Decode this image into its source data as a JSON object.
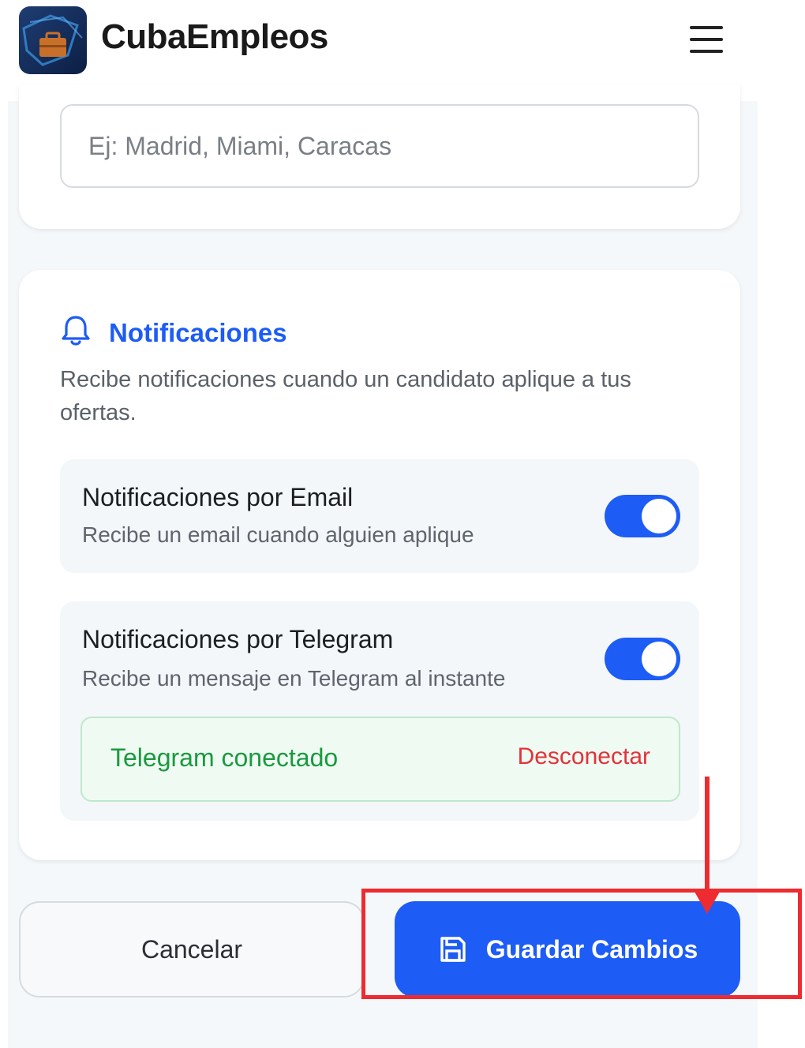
{
  "header": {
    "brand": "CubaEmpleos"
  },
  "location": {
    "placeholder": "Ej: Madrid, Miami, Caracas",
    "value": ""
  },
  "notifications": {
    "title": "Notificaciones",
    "description": "Recibe notificaciones cuando un candidato aplique a tus ofertas.",
    "email": {
      "title": "Notificaciones por Email",
      "subtitle": "Recibe un email cuando alguien aplique",
      "enabled": true
    },
    "telegram": {
      "title": "Notificaciones por Telegram",
      "subtitle": "Recibe un mensaje en Telegram al instante",
      "enabled": true,
      "status_text": "Telegram conectado",
      "disconnect_label": "Desconectar"
    }
  },
  "actions": {
    "cancel_label": "Cancelar",
    "save_label": "Guardar Cambios"
  },
  "icons": {
    "menu": "hamburger-menu-icon",
    "bell": "bell-icon",
    "save": "floppy-disk-icon",
    "logo": "briefcase-logo-icon"
  },
  "colors": {
    "primary": "#1d5cf5",
    "success": "#199a3f",
    "danger": "#e2333a",
    "annotation": "#ee2b30"
  }
}
